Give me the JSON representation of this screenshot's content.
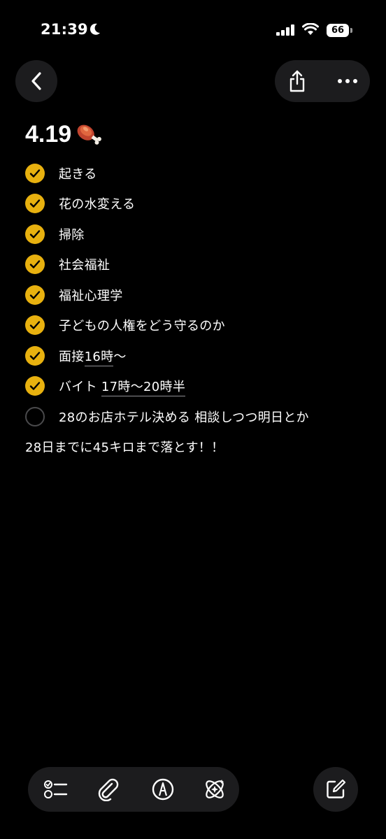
{
  "status_bar": {
    "time": "21:39",
    "battery": "66"
  },
  "note": {
    "title": "4.19",
    "title_emoji": "meat-on-bone-icon",
    "checklist": [
      {
        "text": "起きる",
        "checked": true
      },
      {
        "text": "花の水変える",
        "checked": true
      },
      {
        "text": "掃除",
        "checked": true
      },
      {
        "text": "社会福祉",
        "checked": true
      },
      {
        "text": "福祉心理学",
        "checked": true
      },
      {
        "text": "子どもの人権をどう守るのか",
        "checked": true
      },
      {
        "text_prefix": "面接",
        "text_underlined": "16時",
        "text_suffix": "〜",
        "checked": true
      },
      {
        "text_prefix": "バイト ",
        "text_underlined": "17時〜20時半",
        "checked": true
      },
      {
        "text": "28のお店ホテル決める 相談しつつ明日とか",
        "checked": false
      }
    ],
    "free_text": "28日までに45キロまで落とす！！"
  },
  "colors": {
    "accent": "#e8b10f",
    "background": "#000000",
    "button_bg": "#1c1c1e"
  },
  "toolbar": {
    "items": [
      "checklist-icon",
      "paperclip-icon",
      "pen-markup-icon",
      "writing-tools-icon"
    ],
    "compose": "compose-icon"
  }
}
